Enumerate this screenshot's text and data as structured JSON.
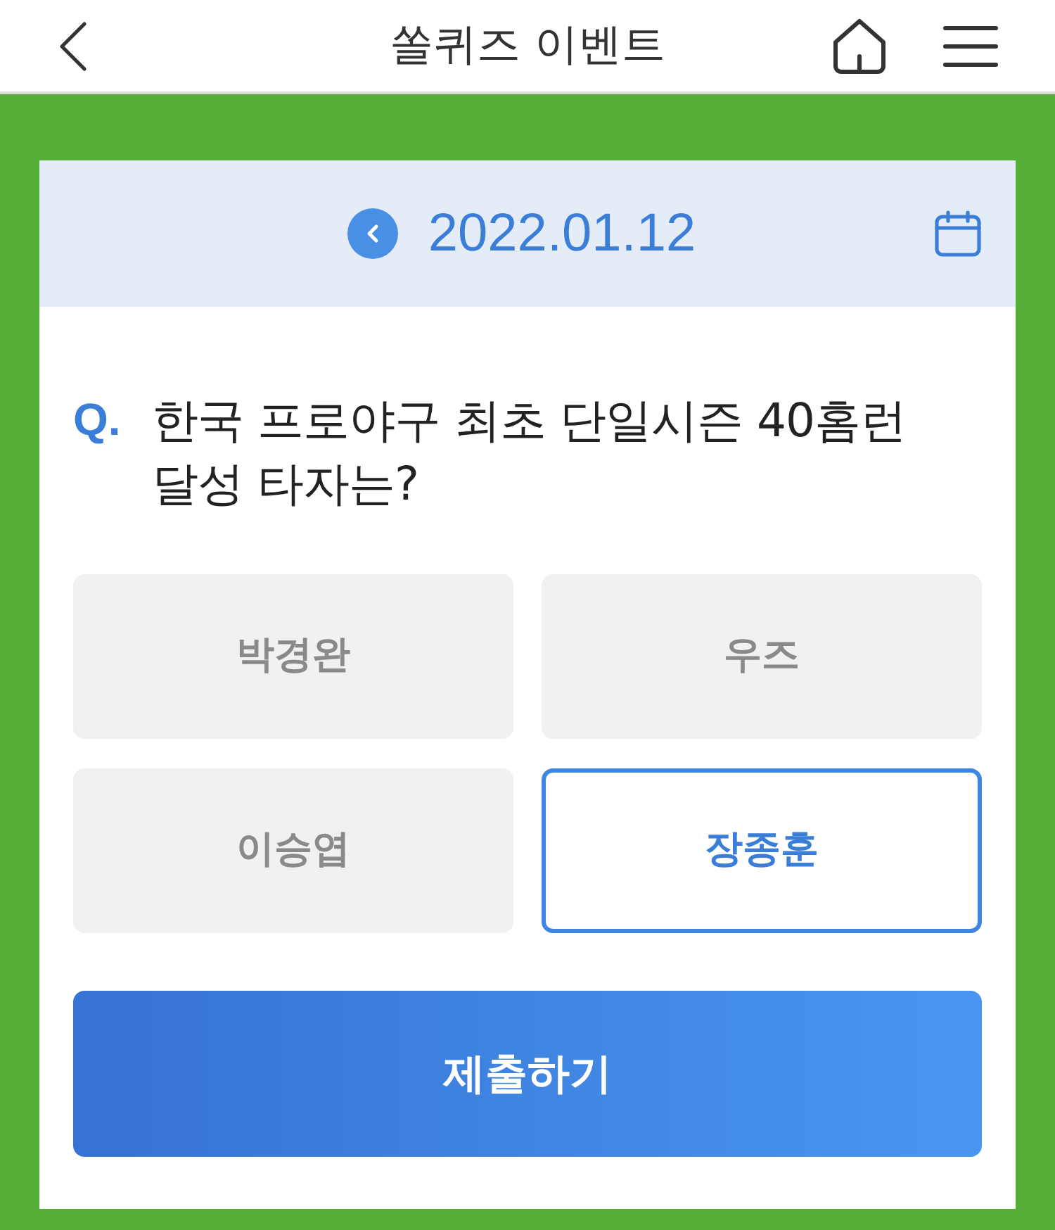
{
  "header": {
    "title": "쏠퀴즈 이벤트"
  },
  "date_bar": {
    "date": "2022.01.12"
  },
  "question": {
    "marker": "Q.",
    "text": "한국 프로야구 최초 단일시즌 40홈런 달성 타자는?"
  },
  "options": [
    {
      "label": "박경완",
      "selected": false
    },
    {
      "label": "우즈",
      "selected": false
    },
    {
      "label": "이승엽",
      "selected": false
    },
    {
      "label": "장종훈",
      "selected": true
    }
  ],
  "submit_button": {
    "label": "제출하기"
  }
}
